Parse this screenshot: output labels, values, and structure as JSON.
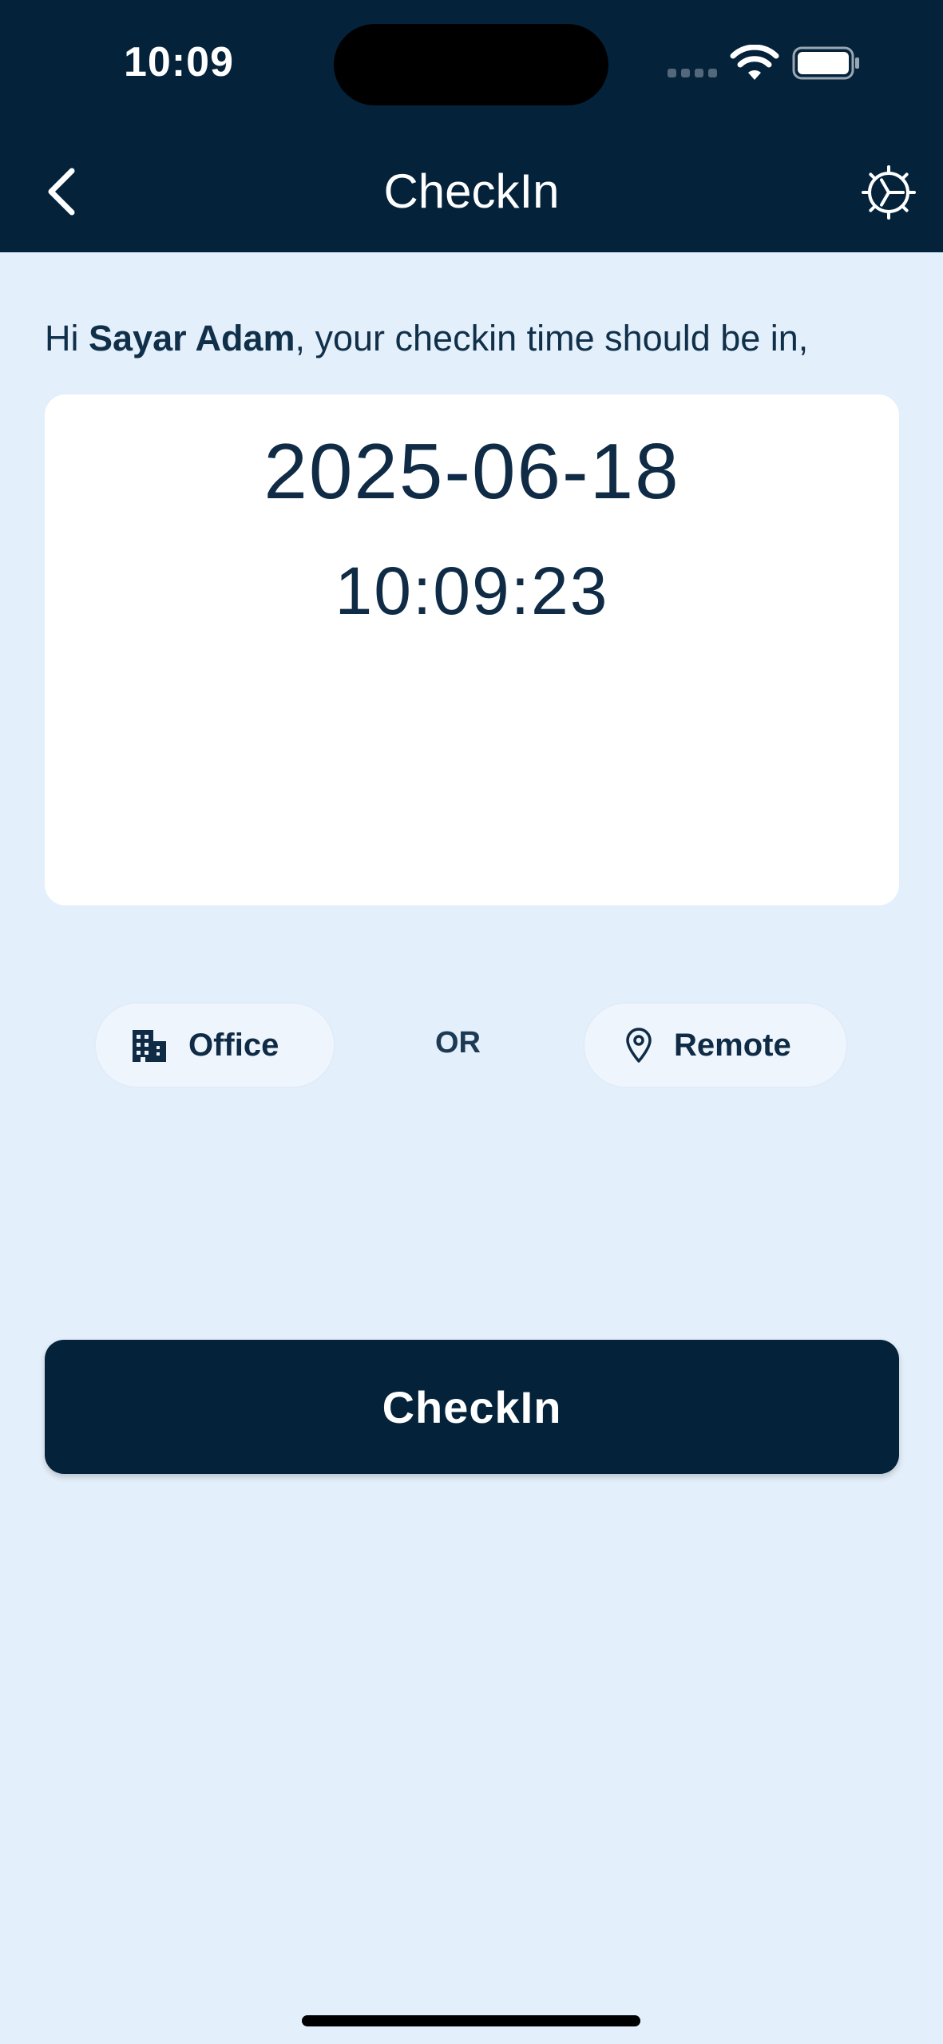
{
  "status_bar": {
    "time": "10:09",
    "icons": [
      "signal-icon",
      "wifi-icon",
      "battery-icon"
    ]
  },
  "nav": {
    "title": "CheckIn",
    "back_icon": "chevron-left-icon",
    "settings_icon": "gear-icon"
  },
  "greeting": {
    "prefix": "Hi ",
    "name": "Sayar Adam",
    "suffix": ", your checkin time should be in,"
  },
  "clock": {
    "date": "2025-06-18",
    "time": "10:09:23"
  },
  "mode": {
    "office_label": "Office",
    "office_icon": "building-icon",
    "or_label": "OR",
    "remote_label": "Remote",
    "remote_icon": "location-pin-icon"
  },
  "action": {
    "checkin_label": "CheckIn"
  },
  "colors": {
    "primary": "#04233b",
    "background": "#e3effb",
    "card": "#ffffff",
    "chip": "#eef5fd"
  }
}
